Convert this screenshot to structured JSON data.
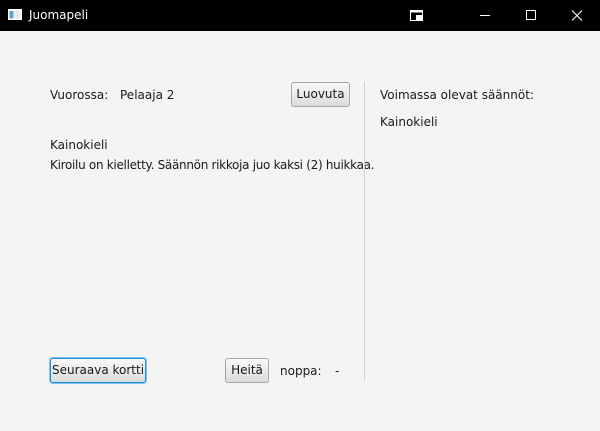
{
  "window": {
    "title": "Juomapeli",
    "controls": [
      "cast-icon",
      "minimize-icon",
      "maximize-icon",
      "close-icon"
    ]
  },
  "turn": {
    "label": "Vuorossa:",
    "player": "Pelaaja 2",
    "give_up_button": "Luovuta"
  },
  "card": {
    "title": "Kainokieli",
    "text": "Kiroilu on kielletty. Säännön rikkoja juo kaksi (2) huikkaa."
  },
  "controls": {
    "next_card_button": "Seuraava kortti",
    "throw_button": "Heitä",
    "dice_label": "noppa:",
    "dice_value": "-"
  },
  "rules_panel": {
    "title": "Voimassa olevat säännöt:",
    "rules": [
      "Kainokieli"
    ]
  },
  "colors": {
    "titlebar": "#000000",
    "background": "#f4f4f4",
    "focus_border": "#1f8fd6"
  }
}
